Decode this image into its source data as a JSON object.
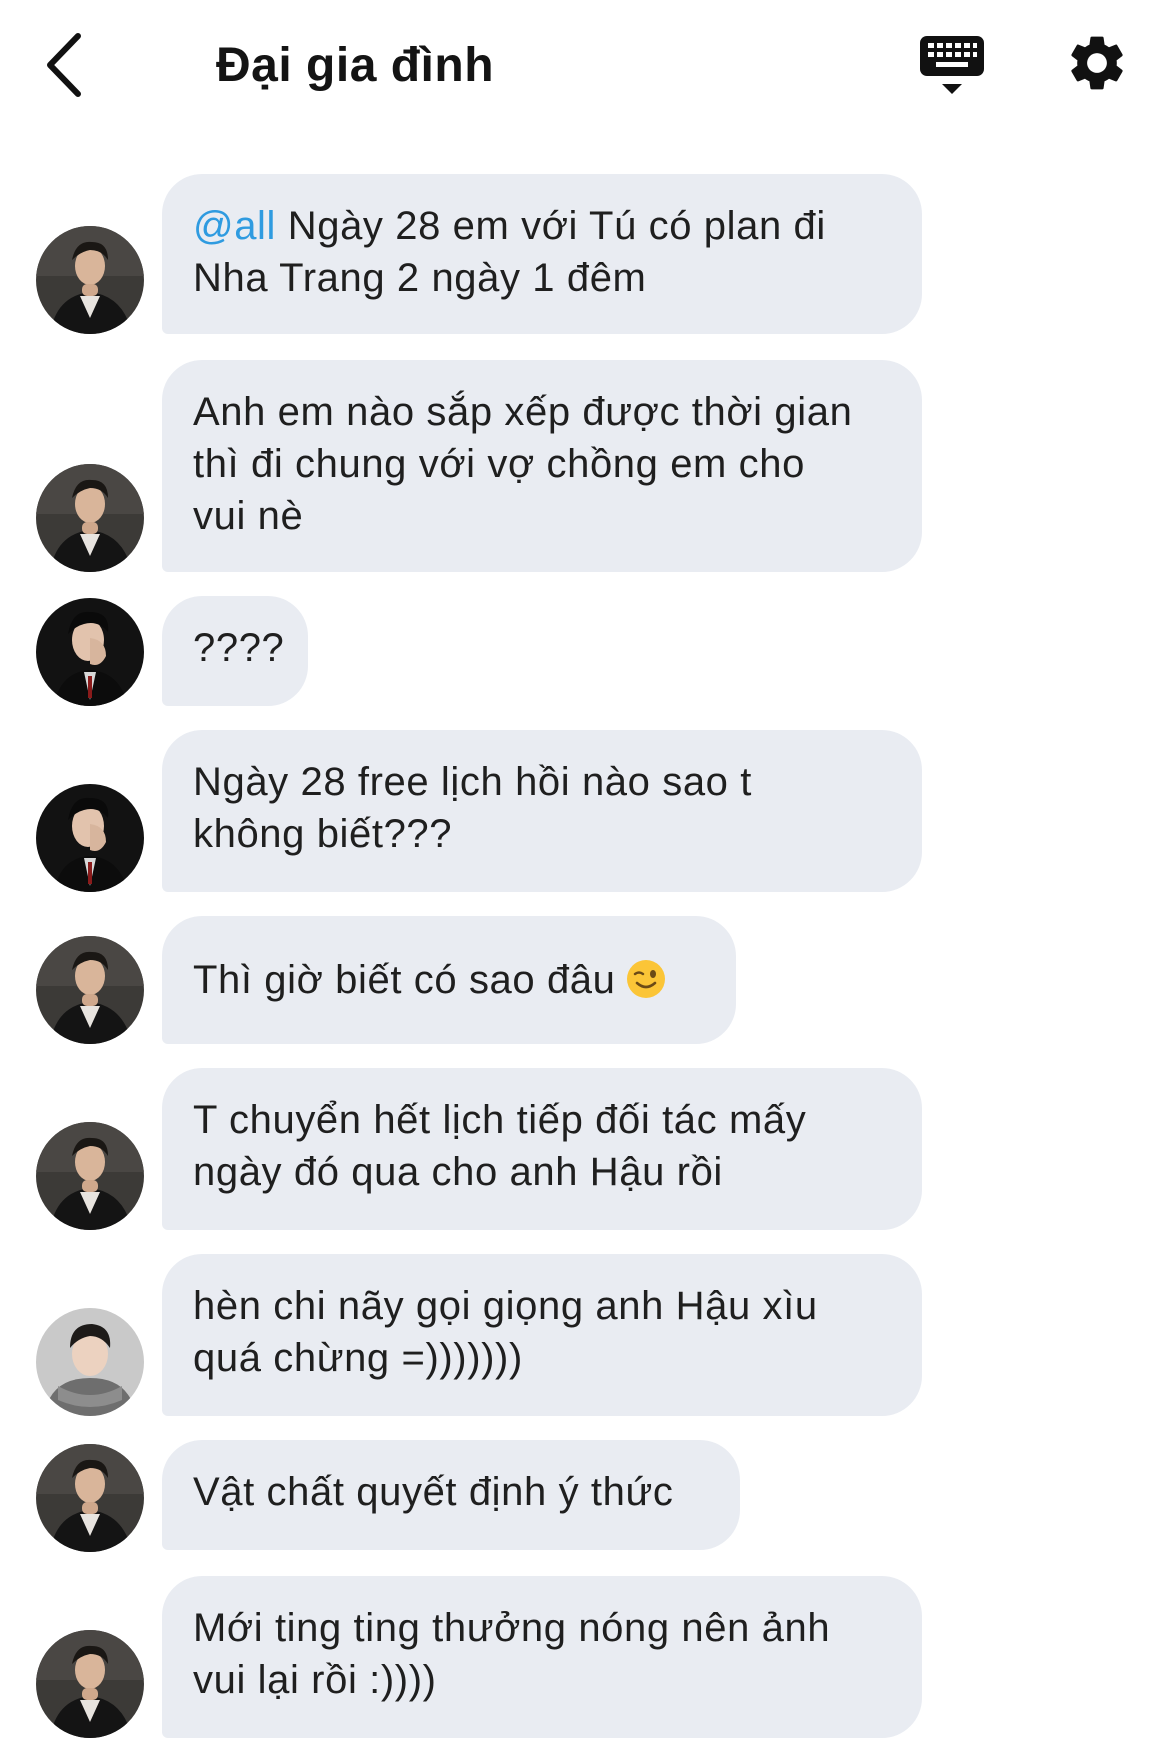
{
  "header": {
    "back_icon": "chevron-left-icon",
    "title": "Đại gia đình",
    "keyboard_icon": "keyboard-icon",
    "settings_icon": "gear-icon"
  },
  "colors": {
    "bubble": "#e9ecf2",
    "mention": "#2f9be0",
    "text": "#1f1f1f"
  },
  "messages": [
    {
      "sender": "a",
      "mention": "@all",
      "text": " Ngày 28 em với Tú có plan đi\nNha Trang 2 ngày 1 đêm"
    },
    {
      "sender": "a",
      "text": "Anh em nào sắp xếp được thời gian\nthì đi chung với vợ chồng em cho\nvui nè"
    },
    {
      "sender": "b",
      "text": "????"
    },
    {
      "sender": "b",
      "text": "Ngày 28 free lịch hồi nào sao t\nkhông biết???"
    },
    {
      "sender": "a",
      "text": "Thì giờ biết có sao đâu",
      "emoji": "winking-face-emoji"
    },
    {
      "sender": "a",
      "text": "T chuyển hết lịch tiếp đối tác mấy\nngày đó qua cho anh Hậu rồi"
    },
    {
      "sender": "c",
      "text": "hèn chi nãy gọi giọng anh Hậu xìu\nquá chừng =)))))))"
    },
    {
      "sender": "a",
      "text": "Vật chất quyết định ý thức"
    },
    {
      "sender": "a",
      "text": "Mới ting ting thưởng nóng nên ảnh\nvui lại rồi :))))"
    }
  ]
}
